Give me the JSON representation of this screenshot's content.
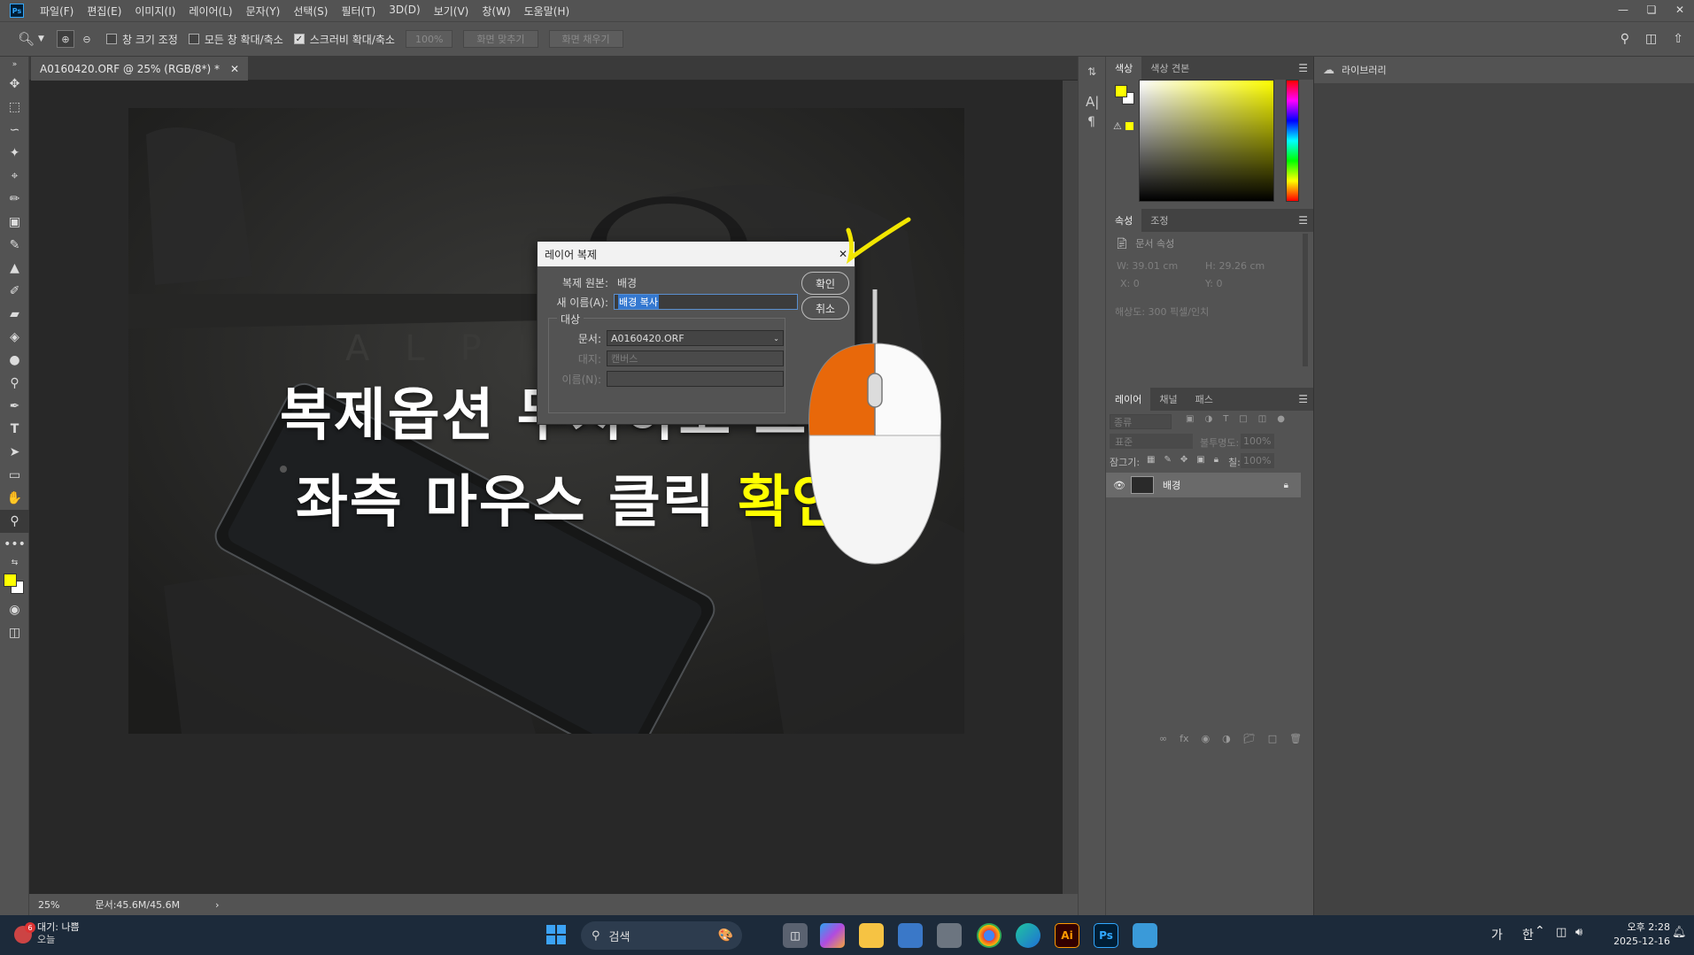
{
  "app": {
    "logo": "Ps",
    "menus": [
      "파일(F)",
      "편집(E)",
      "이미지(I)",
      "레이어(L)",
      "문자(Y)",
      "선택(S)",
      "필터(T)",
      "3D(D)",
      "보기(V)",
      "창(W)",
      "도움말(H)"
    ]
  },
  "options": {
    "resize_windows": "창 크기 조정",
    "zoom_all": "모든 창 확대/축소",
    "scrubby_zoom": "스크러비 확대/축소",
    "zoom_value": "100%",
    "fit_screen": "화면 맞추기",
    "fill_screen": "화면 채우기"
  },
  "document": {
    "tab_title": "A0160420.ORF @ 25% (RGB/8*) *",
    "status_zoom": "25%",
    "status_doc": "문서:45.6M/45.6M"
  },
  "overlay": {
    "line1": "복제옵션 무시하고 그냥",
    "line2_prefix": "좌측 마우스 클릭 ",
    "line2_highlight": "확인",
    "highlight_color": "#ffff00"
  },
  "dialog": {
    "title": "레이어 복제",
    "source_label": "복제 원본:",
    "source_value": "배경",
    "name_label": "새 이름(A):",
    "name_value": "배경 복사",
    "ok": "확인",
    "cancel": "취소",
    "target_group": "대상",
    "doc_label": "문서:",
    "doc_value": "A0160420.ORF",
    "artboard_label": "대지:",
    "artboard_value": "캔버스",
    "name2_label": "이름(N):"
  },
  "color_panel": {
    "tabs": [
      "색상",
      "색상 견본"
    ],
    "foreground": "#ffff00",
    "background": "#ffffff"
  },
  "properties_panel": {
    "tabs": [
      "속성",
      "조정"
    ],
    "doc_props": "문서 속성",
    "w": "W:  39.01 cm",
    "h": "H:  29.26 cm",
    "x": "X:  0",
    "y": "Y:  0",
    "resolution": "해상도: 300 픽셀/인치"
  },
  "layers_panel": {
    "tabs": [
      "레이어",
      "채널",
      "패스"
    ],
    "filter": "종류",
    "blend": "표준",
    "opacity_label": "불투명도:",
    "opacity": "100%",
    "lock_label": "잠그기:",
    "fill_label": "칠:",
    "fill": "100%",
    "layer_name": "배경"
  },
  "library": {
    "title": "라이브러리"
  },
  "taskbar": {
    "weather_badge": "6",
    "weather_title": "대기: 나쁨",
    "weather_sub": "오늘",
    "search_placeholder": "검색",
    "ime1": "가",
    "ime2": "한",
    "time": "오후 2:28",
    "date": "2025-12-16"
  }
}
